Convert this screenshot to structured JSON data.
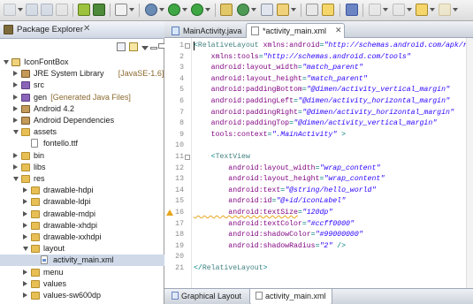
{
  "toolbar": {
    "icons": [
      "new-icon",
      "save-icon",
      "save-all-icon",
      "print-icon",
      "android-sdk-icon",
      "avd-manager-icon",
      "lint-icon",
      "debug-icon",
      "run-icon",
      "external-tools-icon",
      "new-java-package-icon",
      "new-java-class-icon",
      "search-icon",
      "open-type-icon",
      "pin-icon",
      "annotation-icon",
      "back-icon",
      "forward-icon"
    ]
  },
  "package_explorer": {
    "title": "Package Explorer",
    "close_glyph": "✕",
    "tree": [
      {
        "label": "IconFontBox",
        "decoration": "",
        "icon": "project",
        "twisty": "open"
      },
      {
        "label": "JRE System Library",
        "decoration": "[JavaSE-1.6]",
        "icon": "lib",
        "twisty": "closed"
      },
      {
        "label": "src",
        "decoration": "",
        "icon": "pkg",
        "twisty": "closed"
      },
      {
        "label": "gen",
        "decoration": "[Generated Java Files]",
        "icon": "pkg",
        "twisty": "closed"
      },
      {
        "label": "Android 4.2",
        "decoration": "",
        "icon": "lib",
        "twisty": "closed"
      },
      {
        "label": "Android Dependencies",
        "decoration": "",
        "icon": "lib",
        "twisty": "closed"
      },
      {
        "label": "assets",
        "decoration": "",
        "icon": "folder",
        "twisty": "open"
      },
      {
        "label": "fontello.ttf",
        "decoration": "",
        "icon": "file",
        "twisty": ""
      },
      {
        "label": "bin",
        "decoration": "",
        "icon": "folder",
        "twisty": "closed"
      },
      {
        "label": "libs",
        "decoration": "",
        "icon": "folder",
        "twisty": "closed"
      },
      {
        "label": "res",
        "decoration": "",
        "icon": "folder",
        "twisty": "open"
      },
      {
        "label": "drawable-hdpi",
        "decoration": "",
        "icon": "folder",
        "twisty": "closed"
      },
      {
        "label": "drawable-ldpi",
        "decoration": "",
        "icon": "folder",
        "twisty": "closed"
      },
      {
        "label": "drawable-mdpi",
        "decoration": "",
        "icon": "folder",
        "twisty": "closed"
      },
      {
        "label": "drawable-xhdpi",
        "decoration": "",
        "icon": "folder",
        "twisty": "closed"
      },
      {
        "label": "drawable-xxhdpi",
        "decoration": "",
        "icon": "folder",
        "twisty": "closed"
      },
      {
        "label": "layout",
        "decoration": "",
        "icon": "folder",
        "twisty": "open"
      },
      {
        "label": "activity_main.xml",
        "decoration": "",
        "icon": "xml",
        "twisty": ""
      },
      {
        "label": "menu",
        "decoration": "",
        "icon": "folder",
        "twisty": "closed"
      },
      {
        "label": "values",
        "decoration": "",
        "icon": "folder",
        "twisty": "closed"
      },
      {
        "label": "values-sw600dp",
        "decoration": "",
        "icon": "folder",
        "twisty": "closed"
      }
    ]
  },
  "editor": {
    "tabs": [
      {
        "label": "MainActivity.java",
        "active": false
      },
      {
        "label": "*activity_main.xml",
        "active": true
      }
    ],
    "close_glyph": "✕",
    "bottom_tabs": [
      {
        "label": "Graphical Layout",
        "active": false
      },
      {
        "label": "activity_main.xml",
        "active": true
      }
    ],
    "warning_line": 16,
    "lines": [
      {
        "n": "1",
        "parts": [
          [
            "punct",
            "<"
          ],
          [
            "tag",
            "RelativeLayout "
          ],
          [
            "attr",
            "xmlns:android"
          ],
          [
            "punct",
            "="
          ],
          [
            "val",
            "\"http://schemas.android.com/apk/res/android\""
          ]
        ]
      },
      {
        "n": "2",
        "parts": [
          [
            "attr",
            "    xmlns:tools"
          ],
          [
            "punct",
            "="
          ],
          [
            "val",
            "\"http://schemas.android.com/tools\""
          ]
        ]
      },
      {
        "n": "3",
        "parts": [
          [
            "attr",
            "    android:layout_width"
          ],
          [
            "punct",
            "="
          ],
          [
            "val",
            "\"match_parent\""
          ]
        ]
      },
      {
        "n": "4",
        "parts": [
          [
            "attr",
            "    android:layout_height"
          ],
          [
            "punct",
            "="
          ],
          [
            "val",
            "\"match_parent\""
          ]
        ]
      },
      {
        "n": "5",
        "parts": [
          [
            "attr",
            "    android:paddingBottom"
          ],
          [
            "punct",
            "="
          ],
          [
            "val",
            "\"@dimen/activity_vertical_margin\""
          ]
        ]
      },
      {
        "n": "6",
        "parts": [
          [
            "attr",
            "    android:paddingLeft"
          ],
          [
            "punct",
            "="
          ],
          [
            "val",
            "\"@dimen/activity_horizontal_margin\""
          ]
        ]
      },
      {
        "n": "7",
        "parts": [
          [
            "attr",
            "    android:paddingRight"
          ],
          [
            "punct",
            "="
          ],
          [
            "val",
            "\"@dimen/activity_horizontal_margin\""
          ]
        ]
      },
      {
        "n": "8",
        "parts": [
          [
            "attr",
            "    android:paddingTop"
          ],
          [
            "punct",
            "="
          ],
          [
            "val",
            "\"@dimen/activity_vertical_margin\""
          ]
        ]
      },
      {
        "n": "9",
        "parts": [
          [
            "attr",
            "    tools:context"
          ],
          [
            "punct",
            "="
          ],
          [
            "val",
            "\".MainActivity\""
          ],
          [
            "punct",
            " >"
          ]
        ]
      },
      {
        "n": "10",
        "parts": []
      },
      {
        "n": "11",
        "parts": [
          [
            "punct",
            "    <"
          ],
          [
            "tag",
            "TextView"
          ]
        ]
      },
      {
        "n": "12",
        "parts": [
          [
            "attr",
            "        android:layout_width"
          ],
          [
            "punct",
            "="
          ],
          [
            "val",
            "\"wrap_content\""
          ]
        ]
      },
      {
        "n": "13",
        "parts": [
          [
            "attr",
            "        android:layout_height"
          ],
          [
            "punct",
            "="
          ],
          [
            "val",
            "\"wrap_content\""
          ]
        ]
      },
      {
        "n": "14",
        "parts": [
          [
            "attr",
            "        android:text"
          ],
          [
            "punct",
            "="
          ],
          [
            "val",
            "\"@string/hello_world\""
          ]
        ]
      },
      {
        "n": "15",
        "parts": [
          [
            "attr",
            "        android:id"
          ],
          [
            "punct",
            "="
          ],
          [
            "val",
            "\"@+id/iconLabel\""
          ]
        ]
      },
      {
        "n": "16",
        "parts": [
          [
            "attr",
            "        android:textSize"
          ],
          [
            "punct",
            "="
          ],
          [
            "val",
            "\"120dp\""
          ]
        ]
      },
      {
        "n": "17",
        "parts": [
          [
            "attr",
            "        android:textColor"
          ],
          [
            "punct",
            "="
          ],
          [
            "val",
            "\"#ccff0000\""
          ]
        ]
      },
      {
        "n": "18",
        "parts": [
          [
            "attr",
            "        android:shadowColor"
          ],
          [
            "punct",
            "="
          ],
          [
            "val",
            "\"#99000000\""
          ]
        ]
      },
      {
        "n": "19",
        "parts": [
          [
            "attr",
            "        android:shadowRadius"
          ],
          [
            "punct",
            "="
          ],
          [
            "val",
            "\"2\""
          ],
          [
            "punct",
            " />"
          ]
        ]
      },
      {
        "n": "20",
        "parts": []
      },
      {
        "n": "21",
        "parts": [
          [
            "punct",
            "</"
          ],
          [
            "tag",
            "RelativeLayout"
          ],
          [
            "punct",
            ">"
          ]
        ]
      }
    ]
  },
  "colors": {
    "tag": "#3f7f7f",
    "attribute": "#7f007f",
    "value": "#2a00ff",
    "selection": "#cfd9e8",
    "warning": "#e7a51b"
  }
}
